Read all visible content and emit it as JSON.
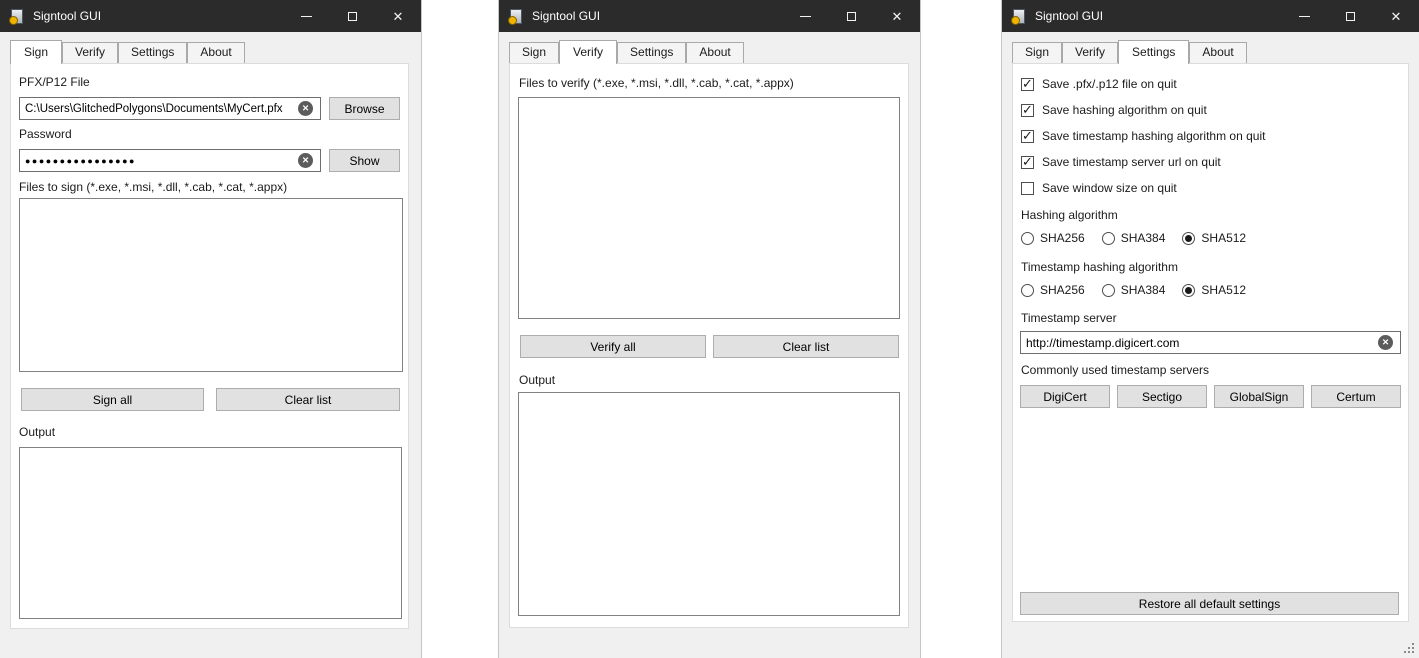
{
  "icons": {
    "clear": "✕",
    "close": "✕",
    "check": "✓"
  },
  "tabs": [
    "Sign",
    "Verify",
    "Settings",
    "About"
  ],
  "windows": [
    {
      "title": "Signtool GUI",
      "active_tab": "Sign"
    },
    {
      "title": "Signtool GUI",
      "active_tab": "Verify"
    },
    {
      "title": "Signtool GUI",
      "active_tab": "Settings"
    }
  ],
  "sign": {
    "pfx_file_label": "PFX/P12 File",
    "pfx_file_value": "C:\\Users\\GlitchedPolygons\\Documents\\MyCert.pfx",
    "browse_button": "Browse",
    "password_label": "Password",
    "password_masked_value": "●●●●●●●●●●●●●●●●",
    "show_button": "Show",
    "files_list_label": "Files to sign (*.exe, *.msi, *.dll, *.cab, *.cat, *.appx)",
    "sign_all_button": "Sign all",
    "clear_list_button": "Clear list",
    "output_label": "Output"
  },
  "verify": {
    "files_list_label": "Files to verify (*.exe, *.msi, *.dll, *.cab, *.cat, *.appx)",
    "verify_all_button": "Verify all",
    "clear_list_button": "Clear list",
    "output_label": "Output"
  },
  "settings": {
    "checkboxes": [
      {
        "label": "Save .pfx/.p12 file on quit",
        "checked": true
      },
      {
        "label": "Save hashing algorithm on quit",
        "checked": true
      },
      {
        "label": "Save timestamp hashing algorithm on quit",
        "checked": true
      },
      {
        "label": "Save timestamp server url on quit",
        "checked": true
      },
      {
        "label": "Save window size on quit",
        "checked": false
      }
    ],
    "hashing_algorithm": {
      "label": "Hashing algorithm",
      "options": [
        {
          "label": "SHA256",
          "selected": false
        },
        {
          "label": "SHA384",
          "selected": false
        },
        {
          "label": "SHA512",
          "selected": true
        }
      ]
    },
    "timestamp_hashing_algorithm": {
      "label": "Timestamp hashing algorithm",
      "options": [
        {
          "label": "SHA256",
          "selected": false
        },
        {
          "label": "SHA384",
          "selected": false
        },
        {
          "label": "SHA512",
          "selected": true
        }
      ]
    },
    "timestamp_server_label": "Timestamp server",
    "timestamp_server_value": "http://timestamp.digicert.com",
    "commonly_used_label": "Commonly used timestamp servers",
    "server_buttons": [
      "DigiCert",
      "Sectigo",
      "GlobalSign",
      "Certum"
    ],
    "restore_button": "Restore all default settings"
  }
}
